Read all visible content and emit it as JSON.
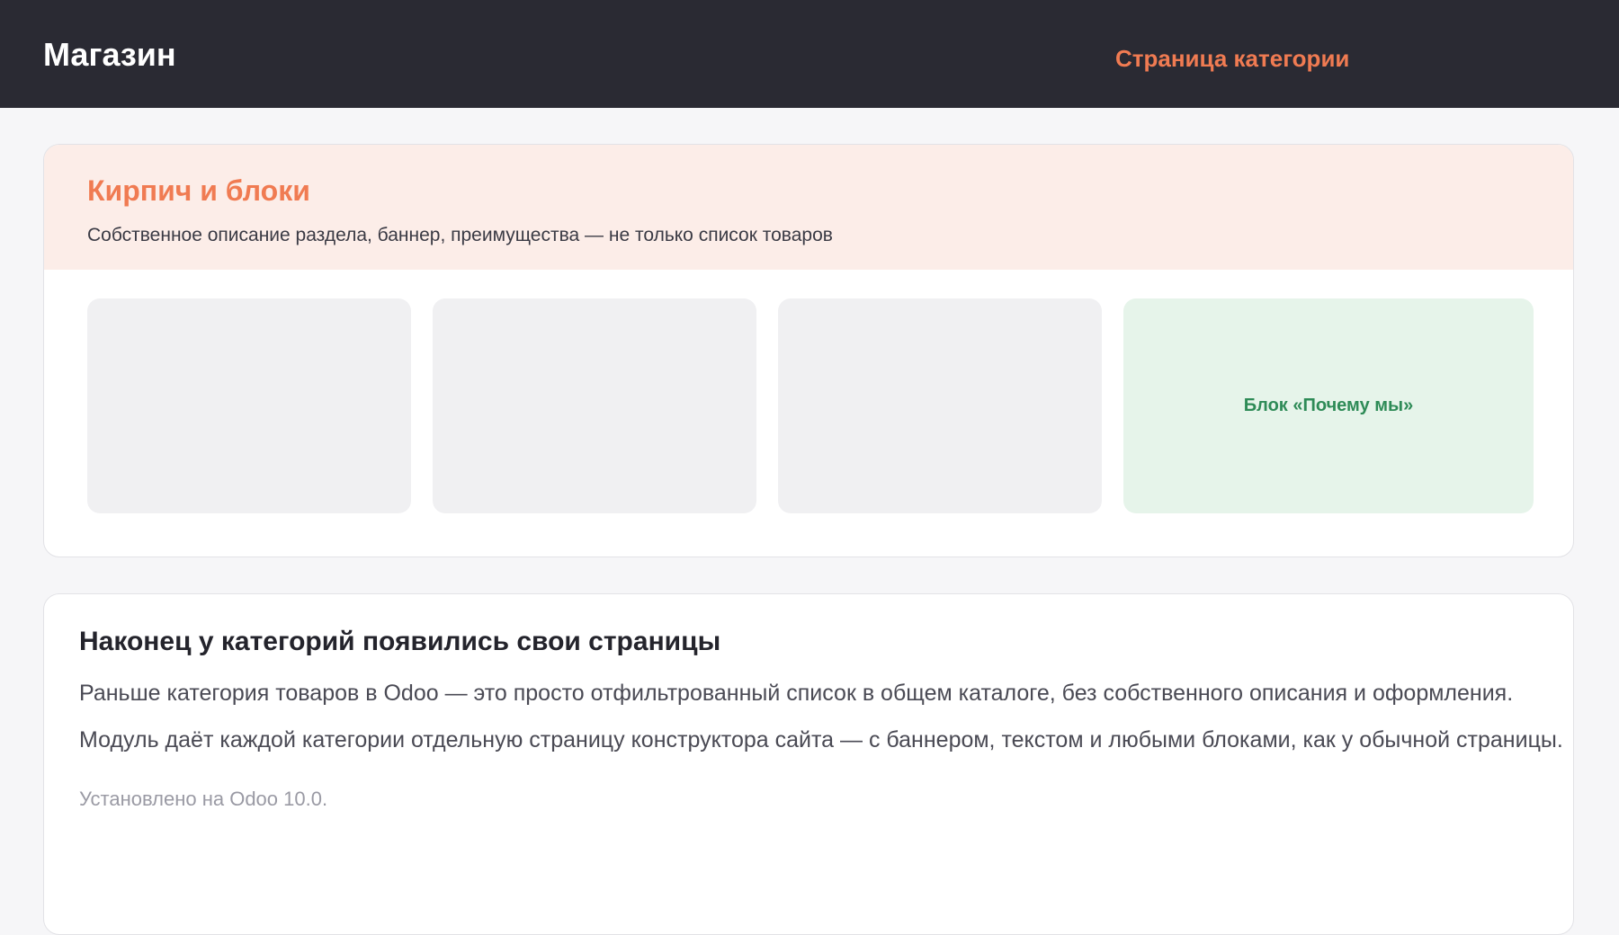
{
  "header": {
    "brand": "Магазин",
    "nav_link": "Страница категории"
  },
  "category_card": {
    "banner": {
      "title": "Кирпич и блоки",
      "description": "Собственное описание раздела, баннер, преимущества — не только список товаров"
    },
    "tiles": [
      {
        "kind": "placeholder"
      },
      {
        "kind": "placeholder"
      },
      {
        "kind": "placeholder"
      },
      {
        "kind": "feature",
        "label": "Блок «Почему мы»"
      }
    ]
  },
  "article": {
    "title": "Наконец у категорий появились свои страницы",
    "paragraphs": [
      "Раньше категория товаров в Odoo — это просто отфильтрованный список в общем каталоге, без собственного описания и оформления.",
      "Модуль даёт каждой категории отдельную страницу конструктора сайта — с баннером, текстом и любыми блоками, как у обычной страницы."
    ],
    "note": "Установлено на Odoo 10.0."
  },
  "colors": {
    "header_bg": "#2a2a33",
    "accent": "#f07b52",
    "banner_bg": "#fcede8",
    "tile_bg": "#f0f0f2",
    "feature_bg": "#e6f4ea",
    "feature_text": "#2e8b57",
    "page_bg": "#f6f6f8"
  }
}
